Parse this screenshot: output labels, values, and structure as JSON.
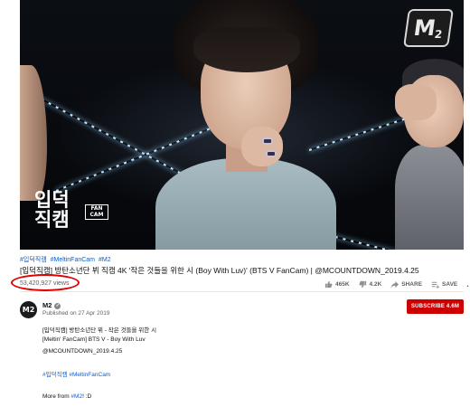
{
  "player": {
    "logo": {
      "letter": "M",
      "number": "2"
    },
    "watermark": {
      "line1": "입덕",
      "line2": "직캠",
      "badge": "FAN CAM"
    }
  },
  "video": {
    "tags": [
      "#입덕직캠",
      "#MeltinFanCam",
      "#M2"
    ],
    "title": "[입덕직캠] 방탄소년단 뷔 직캠 4K '작은 것들을 위한 시 (Boy With Luv)' (BTS V FanCam) | @MCOUNTDOWN_2019.4.25",
    "views": "53,420,927 views",
    "actions": {
      "likes": "465K",
      "dislikes": "4.2K",
      "share": "SHARE",
      "save": "SAVE",
      "more": "..."
    }
  },
  "channel": {
    "avatar_text": "M2",
    "name": "M2",
    "verified_icon": "check",
    "published": "Published on 27 Apr 2019",
    "subscribe": "SUBSCRIBE  4.6M"
  },
  "description": {
    "line1": "[입덕직캠] 방탄소년단 뷔 - 작은 것들을 위한 시",
    "line2": "[Meltin' FanCam] BTS V - Boy With Luv",
    "line3": "@MCOUNTDOWN_2019.4.25",
    "tags": "#입덕직캠 #MeltinFanCam",
    "more_prefix": "More from ",
    "more_link": "#M2",
    "more_suffix": "! :D"
  },
  "colors": {
    "link": "#065fd4",
    "subscribe": "#cc0000",
    "annotation_circle": "#e00000"
  }
}
